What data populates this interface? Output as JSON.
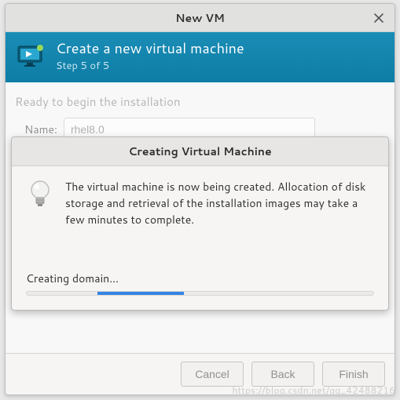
{
  "window": {
    "title": "New VM"
  },
  "header": {
    "title": "Create a new virtual machine",
    "step": "Step 5 of 5"
  },
  "form": {
    "ready_label": "Ready to begin the installation",
    "name_label": "Name:",
    "name_value": "rhel8.0"
  },
  "modal": {
    "title": "Creating Virtual Machine",
    "message": "The virtual machine is now being created. Allocation of disk storage and retrieval of the installation images may take a few minutes to complete.",
    "status": "Creating domain..."
  },
  "buttons": {
    "cancel": "Cancel",
    "back": "Back",
    "finish": "Finish"
  },
  "watermark": "https://blog.csdn.net/qq_42488216"
}
